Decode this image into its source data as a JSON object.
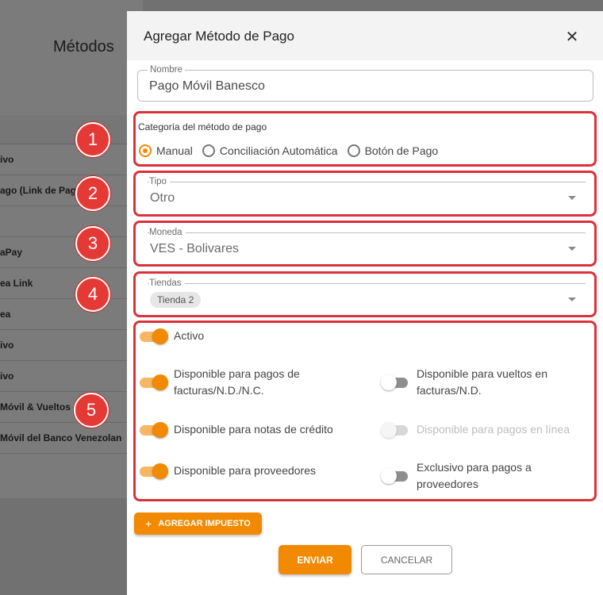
{
  "background": {
    "title": "Métodos",
    "rows": [
      "ivo",
      "ago (Link de Pago",
      "",
      "aPay",
      "ea Link",
      "ea",
      "ivo",
      "ivo",
      "Móvil & Vueltos",
      "Móvil del Banco Venezolan"
    ]
  },
  "drawer": {
    "title": "Agregar Método de Pago",
    "close_icon": "close-icon",
    "name": {
      "legend": "Nombre",
      "value": "Pago Móvil Banesco"
    },
    "category": {
      "label": "Categoría del método de pago",
      "options": [
        {
          "label": "Manual",
          "selected": true
        },
        {
          "label": "Conciliación Automática",
          "selected": false
        },
        {
          "label": "Botón de Pago",
          "selected": false
        }
      ]
    },
    "type": {
      "legend": "Tipo",
      "value": "Otro"
    },
    "currency": {
      "legend": "Moneda",
      "value": "VES - Bolivares"
    },
    "stores": {
      "legend": "Tiendas",
      "chips": [
        "Tienda 2"
      ]
    },
    "switches": {
      "active": {
        "label": "Activo",
        "on": true
      },
      "invoice_payments": {
        "label_line1": "Disponible para pagos de",
        "label_line2": "facturas/N.D./N.C.",
        "on": true
      },
      "change_invoices": {
        "label_line1": "Disponible para vueltos en",
        "label_line2": "facturas/N.D.",
        "on": false
      },
      "credit_notes": {
        "label": "Disponible para notas de crédito",
        "on": true
      },
      "online_payments": {
        "label": "Disponible para pagos en línea",
        "on": false,
        "disabled": true
      },
      "suppliers": {
        "label": "Disponible para proveedores",
        "on": true
      },
      "supplier_exclusive": {
        "label_line1": "Exclusivo para pagos a",
        "label_line2": "proveedores",
        "on": false
      }
    },
    "add_tax_button": {
      "icon": "plus-icon",
      "label": "AGREGAR IMPUESTO"
    },
    "submit_button": "ENVIAR",
    "cancel_button": "CANCELAR"
  },
  "annotations": {
    "badges": [
      "1",
      "2",
      "3",
      "4",
      "5"
    ]
  },
  "colors": {
    "accent": "#f18a00",
    "highlight": "#d9323a",
    "badge": "#e53935",
    "overlay": "#717171"
  }
}
